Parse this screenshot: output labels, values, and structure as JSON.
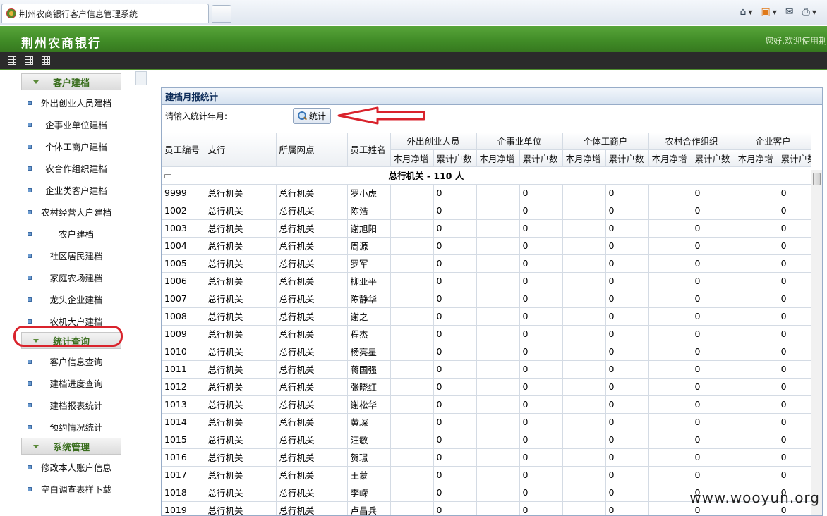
{
  "browser": {
    "tab_title": "荆州农商银行客户信息管理系统"
  },
  "app": {
    "title": "荆州农商银行",
    "welcome": "您好,欢迎使用荆"
  },
  "sidebar": {
    "sections": [
      {
        "title": "客户建档",
        "items": [
          "外出创业人员建档",
          "企事业单位建档",
          "个体工商户建档",
          "农合作组织建档",
          "企业类客户建档",
          "农村经营大户建档",
          "农户建档",
          "社区居民建档",
          "家庭农场建档",
          "龙头企业建档",
          "农机大户建档"
        ]
      },
      {
        "title": "统计查询",
        "items": [
          "客户信息查询",
          "建档进度查询",
          "建档报表统计",
          "预约情况统计"
        ]
      },
      {
        "title": "系统管理",
        "items": [
          "修改本人账户信息",
          "空白调查表样下载"
        ]
      }
    ],
    "active_item": "建档报表统计"
  },
  "panel": {
    "title": "建档月报统计",
    "query_label": "请输入统计年月:",
    "query_value": "",
    "search_button": "统计"
  },
  "table": {
    "headers": {
      "emp_id": "员工编号",
      "branch": "支行",
      "outlet": "所属网点",
      "name": "员工姓名",
      "groups": [
        "外出创业人员",
        "企事业单位",
        "个体工商户",
        "农村合作组织",
        "企业客户"
      ],
      "sub": [
        "本月净增",
        "累计户数"
      ]
    },
    "group_row": "总行机关 - 110 人",
    "rows": [
      [
        "9999",
        "总行机关",
        "总行机关",
        "罗小虎",
        "",
        "0",
        "",
        "0",
        "",
        "0",
        "",
        "0",
        "",
        "0"
      ],
      [
        "1002",
        "总行机关",
        "总行机关",
        "陈浩",
        "",
        "0",
        "",
        "0",
        "",
        "0",
        "",
        "0",
        "",
        "0"
      ],
      [
        "1003",
        "总行机关",
        "总行机关",
        "谢旭阳",
        "",
        "0",
        "",
        "0",
        "",
        "0",
        "",
        "0",
        "",
        "0"
      ],
      [
        "1004",
        "总行机关",
        "总行机关",
        "周源",
        "",
        "0",
        "",
        "0",
        "",
        "0",
        "",
        "0",
        "",
        "0"
      ],
      [
        "1005",
        "总行机关",
        "总行机关",
        "罗军",
        "",
        "0",
        "",
        "0",
        "",
        "0",
        "",
        "0",
        "",
        "0"
      ],
      [
        "1006",
        "总行机关",
        "总行机关",
        "柳亚平",
        "",
        "0",
        "",
        "0",
        "",
        "0",
        "",
        "0",
        "",
        "0"
      ],
      [
        "1007",
        "总行机关",
        "总行机关",
        "陈静华",
        "",
        "0",
        "",
        "0",
        "",
        "0",
        "",
        "0",
        "",
        "0"
      ],
      [
        "1008",
        "总行机关",
        "总行机关",
        "谢之",
        "",
        "0",
        "",
        "0",
        "",
        "0",
        "",
        "0",
        "",
        "0"
      ],
      [
        "1009",
        "总行机关",
        "总行机关",
        "程杰",
        "",
        "0",
        "",
        "0",
        "",
        "0",
        "",
        "0",
        "",
        "0"
      ],
      [
        "1010",
        "总行机关",
        "总行机关",
        "杨亮星",
        "",
        "0",
        "",
        "0",
        "",
        "0",
        "",
        "0",
        "",
        "0"
      ],
      [
        "1011",
        "总行机关",
        "总行机关",
        "蒋国强",
        "",
        "0",
        "",
        "0",
        "",
        "0",
        "",
        "0",
        "",
        "0"
      ],
      [
        "1012",
        "总行机关",
        "总行机关",
        "张晓红",
        "",
        "0",
        "",
        "0",
        "",
        "0",
        "",
        "0",
        "",
        "0"
      ],
      [
        "1013",
        "总行机关",
        "总行机关",
        "谢松华",
        "",
        "0",
        "",
        "0",
        "",
        "0",
        "",
        "0",
        "",
        "0"
      ],
      [
        "1014",
        "总行机关",
        "总行机关",
        "黄琛",
        "",
        "0",
        "",
        "0",
        "",
        "0",
        "",
        "0",
        "",
        "0"
      ],
      [
        "1015",
        "总行机关",
        "总行机关",
        "汪敏",
        "",
        "0",
        "",
        "0",
        "",
        "0",
        "",
        "0",
        "",
        "0"
      ],
      [
        "1016",
        "总行机关",
        "总行机关",
        "贺璟",
        "",
        "0",
        "",
        "0",
        "",
        "0",
        "",
        "0",
        "",
        "0"
      ],
      [
        "1017",
        "总行机关",
        "总行机关",
        "王蒙",
        "",
        "0",
        "",
        "0",
        "",
        "0",
        "",
        "0",
        "",
        "0"
      ],
      [
        "1018",
        "总行机关",
        "总行机关",
        "李嵘",
        "",
        "0",
        "",
        "0",
        "",
        "0",
        "",
        "0",
        "",
        "0"
      ],
      [
        "1019",
        "总行机关",
        "总行机关",
        "卢昌兵",
        "",
        "0",
        "",
        "0",
        "",
        "0",
        "",
        "0",
        "",
        "0"
      ]
    ]
  },
  "watermark": "www.wooyun.org",
  "colors": {
    "header_green": "#3f8a26",
    "highlight_red": "#d9232c",
    "panel_border": "#97acc8"
  }
}
